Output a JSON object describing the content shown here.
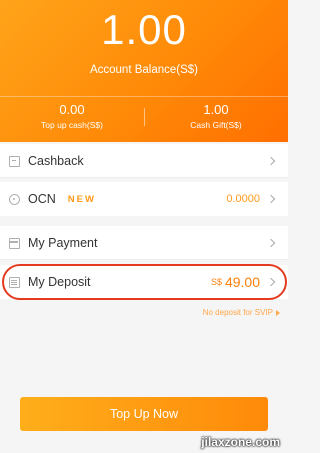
{
  "header": {
    "balance_amount": "1.00",
    "balance_label": "Account Balance(S$)",
    "topup_cash_value": "0.00",
    "topup_cash_label": "Top up cash(S$)",
    "cash_gift_value": "1.00",
    "cash_gift_label": "Cash Gift(S$)"
  },
  "menu": {
    "cashback": {
      "label": "Cashback",
      "icon": "cashback-icon"
    },
    "ocn": {
      "label": "OCN",
      "badge": "NEW",
      "value": "0.0000",
      "icon": "ocn-icon"
    },
    "payment": {
      "label": "My Payment",
      "icon": "payment-icon"
    },
    "deposit": {
      "label": "My Deposit",
      "currency": "S$",
      "value": "49.00",
      "icon": "deposit-icon"
    }
  },
  "deposit_note": "No deposit for SVIP",
  "topup_button": "Top Up Now",
  "watermark": "jilaxzone.com",
  "colors": {
    "accent": "#ff8a08",
    "annotation": "#e43b20"
  }
}
